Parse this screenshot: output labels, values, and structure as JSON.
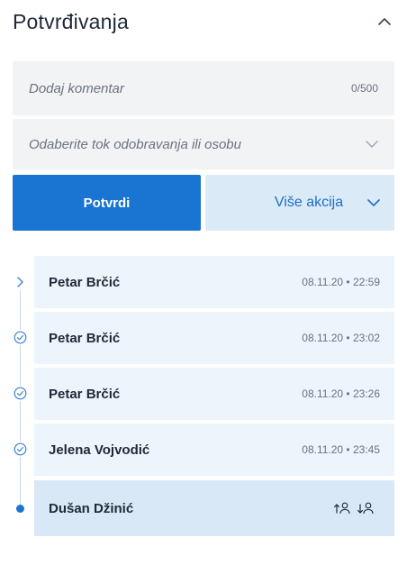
{
  "header": {
    "title": "Potvrđivanja",
    "collapse_icon": "chevron-up-icon"
  },
  "comment": {
    "placeholder": "Dodaj komentar",
    "value": "",
    "counter": "0/500"
  },
  "flow_select": {
    "placeholder": "Odaberite tok odobravanja ili osobu",
    "icon": "chevron-down-icon"
  },
  "actions": {
    "confirm_label": "Potvrdi",
    "more_label": "Više akcija",
    "more_icon": "chevron-down-icon"
  },
  "timeline": {
    "items": [
      {
        "name": "Petar Brčić",
        "date": "08.11.20 • 22:59",
        "status_icon": "chevron-right-icon"
      },
      {
        "name": "Petar Brčić",
        "date": "08.11.20 • 23:02",
        "status_icon": "check-circle-icon"
      },
      {
        "name": "Petar Brčić",
        "date": "08.11.20 • 23:26",
        "status_icon": "check-circle-icon"
      },
      {
        "name": "Jelena Vojvodić",
        "date": "08.11.20 • 23:45",
        "status_icon": "check-circle-icon"
      },
      {
        "name": "Dušan Džinić",
        "date": "",
        "status_icon": "current-dot-icon",
        "active": true
      }
    ],
    "active_actions": [
      "move-up-user-icon",
      "move-down-user-icon"
    ]
  },
  "colors": {
    "primary": "#1a75d2",
    "primary_light": "#dbeaf7",
    "row_bg": "#edf4fc",
    "row_active_bg": "#d9e8f6",
    "field_bg": "#f2f3f5"
  }
}
